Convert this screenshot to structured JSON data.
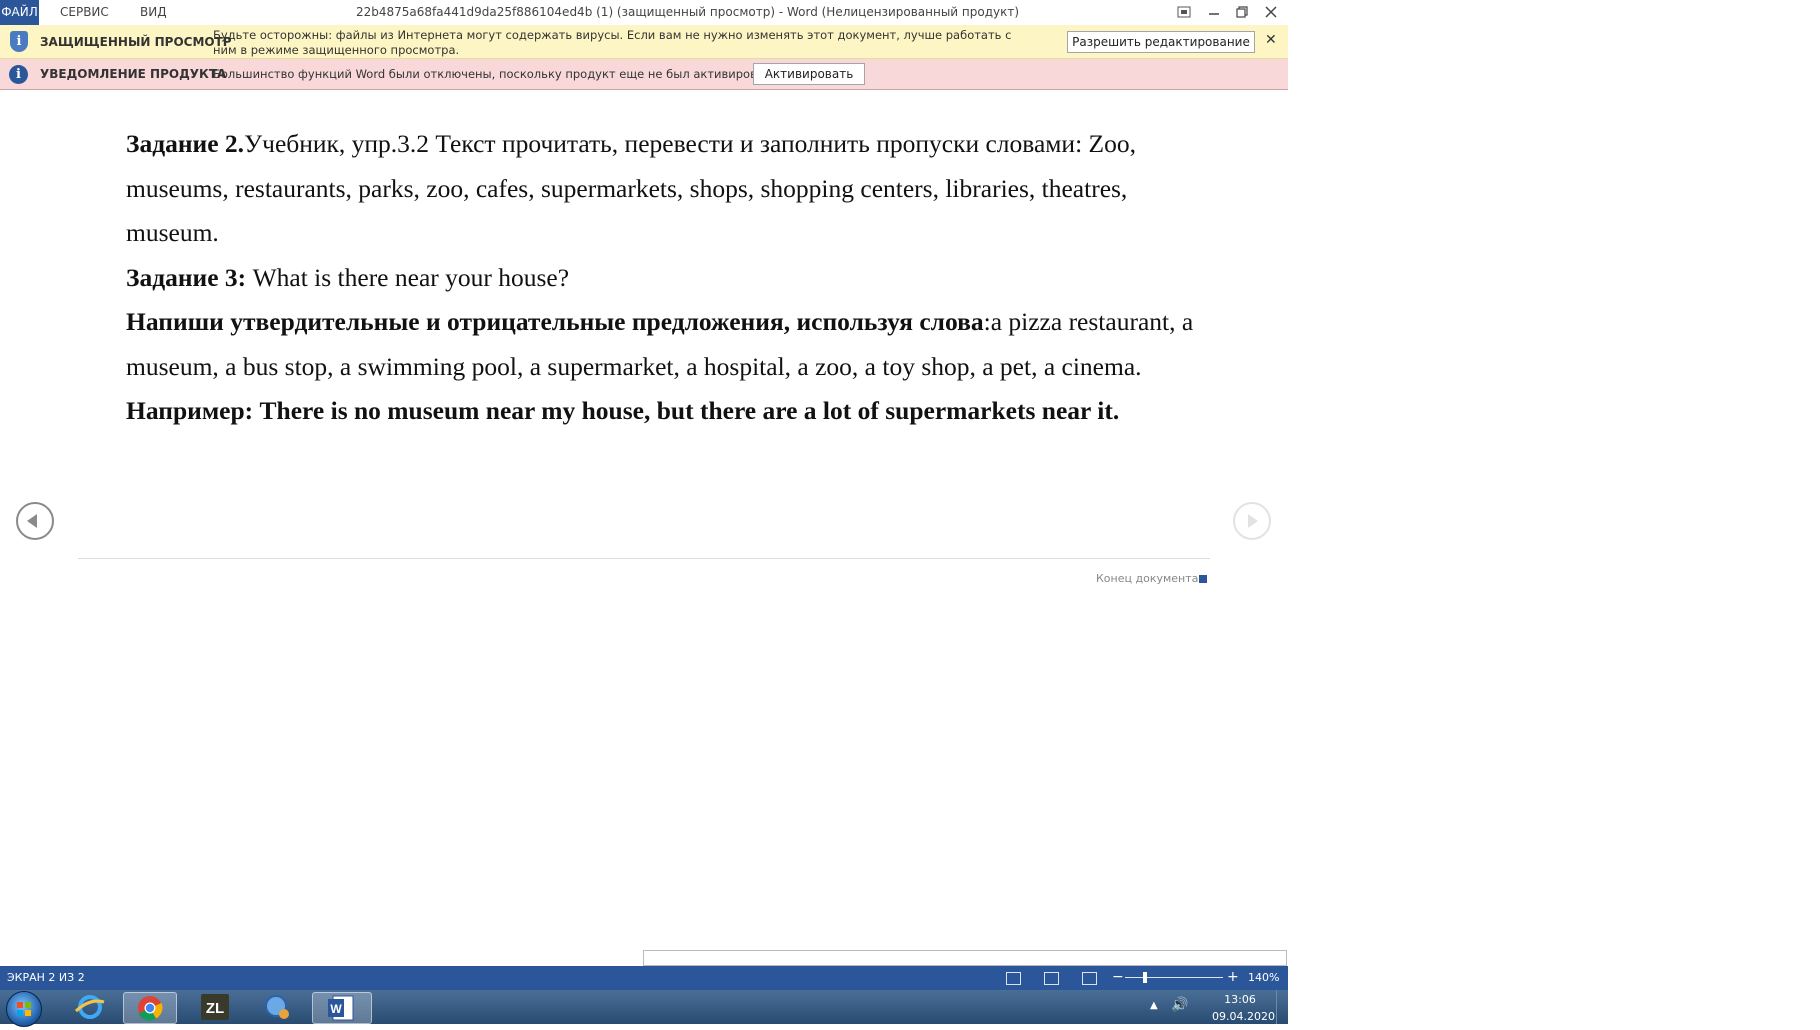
{
  "menu": {
    "file": "ФАЙЛ",
    "service": "СЕРВИС",
    "view": "ВИД"
  },
  "window": {
    "title": "22b4875a68fa441d9da25f886104ed4b (1) (защищенный просмотр) - Word (Нелицензированный продукт)"
  },
  "protected_bar": {
    "title": "ЗАЩИЩЕННЫЙ ПРОСМОТР",
    "text": "Будьте осторожны: файлы из Интернета могут содержать вирусы. Если вам не нужно изменять этот документ, лучше работать с ним в режиме защищенного просмотра.",
    "button": "Разрешить редактирование",
    "close": "✕"
  },
  "notice_bar": {
    "title": "УВЕДОМЛЕНИЕ ПРОДУКТА",
    "text": "Большинство функций Word были отключены, поскольку продукт еще не был активирован.",
    "button": "Активировать"
  },
  "document": {
    "p1_bold": "Задание 2.",
    "p1_text": "Учебник, упр.3.2 Текст прочитать, перевести и заполнить пропуски словами: Zoo, museums, restaurants, parks, zoo, cafes, supermarkets, shops, shopping centers, libraries, theatres, museum.",
    "p2_bold": "Задание 3:",
    "p2_text": " What is there near your house?",
    "p3_bold": "Напиши утвердительные и отрицательные предложения, используя слова",
    "p3_text": ":a pizza restaurant, a museum, a bus stop, a swimming pool, a supermarket, a hospital, a zoo, a toy shop, a pet, a cinema.",
    "p4_bold": "Например: There is no museum near my house, but there are a lot of supermarkets near it.",
    "end_label": "Конец документа"
  },
  "status": {
    "page": "ЭКРАН 2 ИЗ 2",
    "zoom_minus": "−",
    "zoom_plus": "+",
    "zoom": "140%",
    "zoom_level_percent": 140
  },
  "taskbar": {
    "apps": [
      "start-orb",
      "internet-explorer",
      "chrome",
      "zl-app",
      "search-app",
      "word"
    ],
    "time": "13:06",
    "date": "09.04.2020"
  },
  "colors": {
    "accent": "#2b579a",
    "protected_bar": "#fdf6c4",
    "notice_bar": "#f9d8da"
  }
}
